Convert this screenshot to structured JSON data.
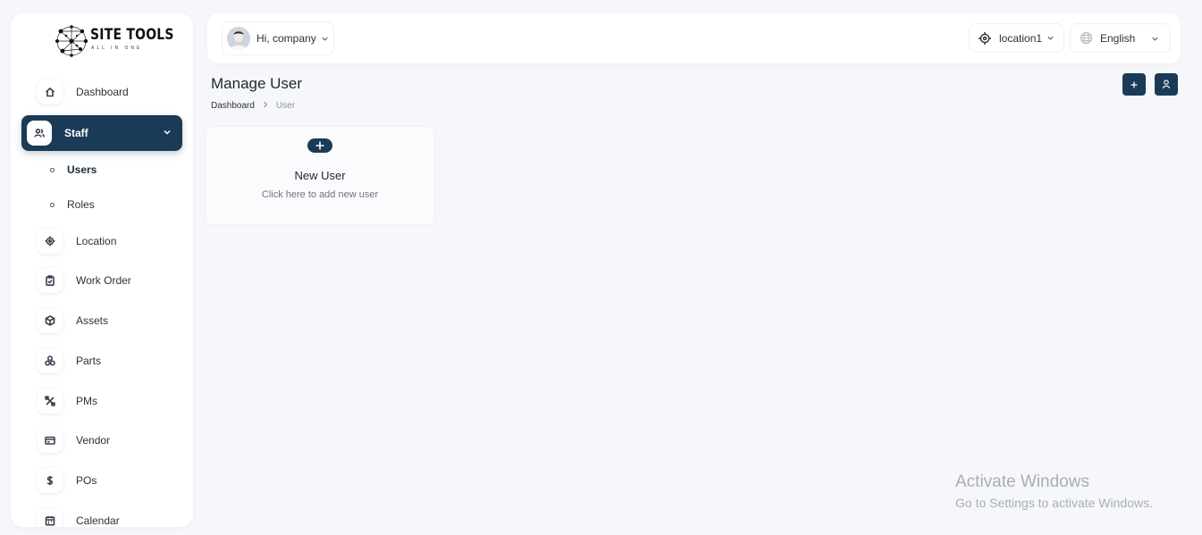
{
  "app": {
    "logo_title": "SITE TOOLS",
    "logo_subtitle": "ALL IN ONE"
  },
  "sidebar": {
    "items": [
      {
        "label": "Dashboard",
        "icon": "home-icon"
      },
      {
        "label": "Staff",
        "icon": "users-icon",
        "active": true
      },
      {
        "label": "Location",
        "icon": "target-icon"
      },
      {
        "label": "Work Order",
        "icon": "clipboard-icon"
      },
      {
        "label": "Assets",
        "icon": "box-icon"
      },
      {
        "label": "Parts",
        "icon": "parts-icon"
      },
      {
        "label": "PMs",
        "icon": "tools-icon"
      },
      {
        "label": "Vendor",
        "icon": "vendor-icon"
      },
      {
        "label": "POs",
        "icon": "dollar-icon"
      },
      {
        "label": "Calendar",
        "icon": "calendar-icon"
      }
    ],
    "staff_sub": [
      {
        "label": "Users",
        "current": true
      },
      {
        "label": "Roles"
      }
    ]
  },
  "header": {
    "greeting": "Hi, company",
    "location": "location1",
    "language": "English"
  },
  "page": {
    "title": "Manage User",
    "breadcrumb": {
      "home": "Dashboard",
      "current": "User"
    }
  },
  "new_user_card": {
    "title": "New User",
    "subtitle": "Click here to add new user"
  },
  "watermark": {
    "title": "Activate Windows",
    "subtitle": "Go to Settings to activate Windows."
  },
  "colors": {
    "accent": "#1b3a57",
    "background": "#f6f7fb"
  }
}
